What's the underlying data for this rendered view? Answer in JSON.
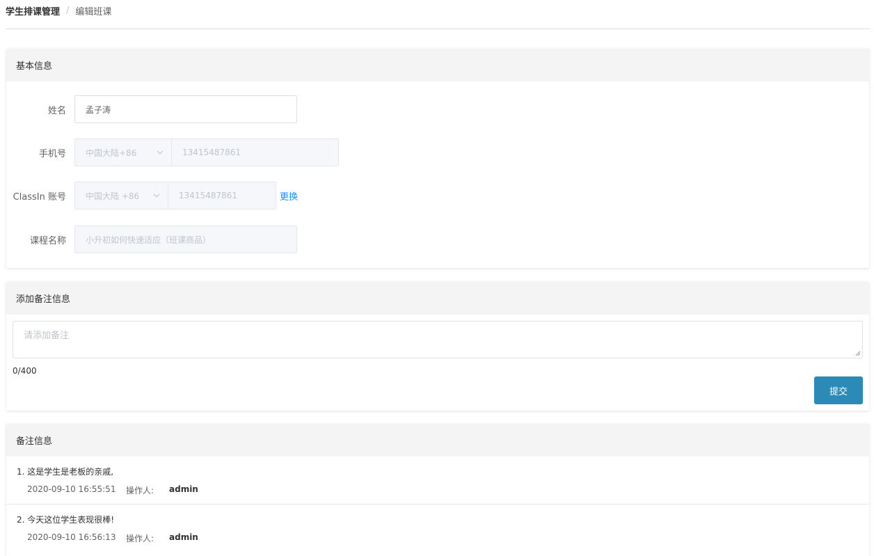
{
  "breadcrumb": {
    "root": "学生排课管理",
    "separator": "/",
    "current": "编辑班课"
  },
  "basic": {
    "title": "基本信息",
    "name_label": "姓名",
    "name_value": "孟子涛",
    "phone_label": "手机号",
    "phone_region": "中国大陆+86",
    "phone_number": "13415487861",
    "classin_label": "ClassIn 账号",
    "classin_region": "中国大陆 +86",
    "classin_number": "13415487861",
    "change_link": "更换",
    "course_label": "课程名称",
    "course_value": "小升初如何快速适应（班课商品）"
  },
  "remark": {
    "title": "添加备注信息",
    "placeholder": "请添加备注",
    "counter": "0/400",
    "submit_label": "提交"
  },
  "notes": {
    "title": "备注信息",
    "items": [
      {
        "text": "1. 这是学生是老板的亲戚,",
        "time": "2020-09-10 16:55:51",
        "operator_label": "操作人:",
        "operator": "admin"
      },
      {
        "text": "2. 今天这位学生表现很棒!",
        "time": "2020-09-10 16:56:13",
        "operator_label": "操作人:",
        "operator": "admin"
      }
    ]
  },
  "colors": {
    "primary_button": "#2b8ab6",
    "link": "#1890ff"
  }
}
